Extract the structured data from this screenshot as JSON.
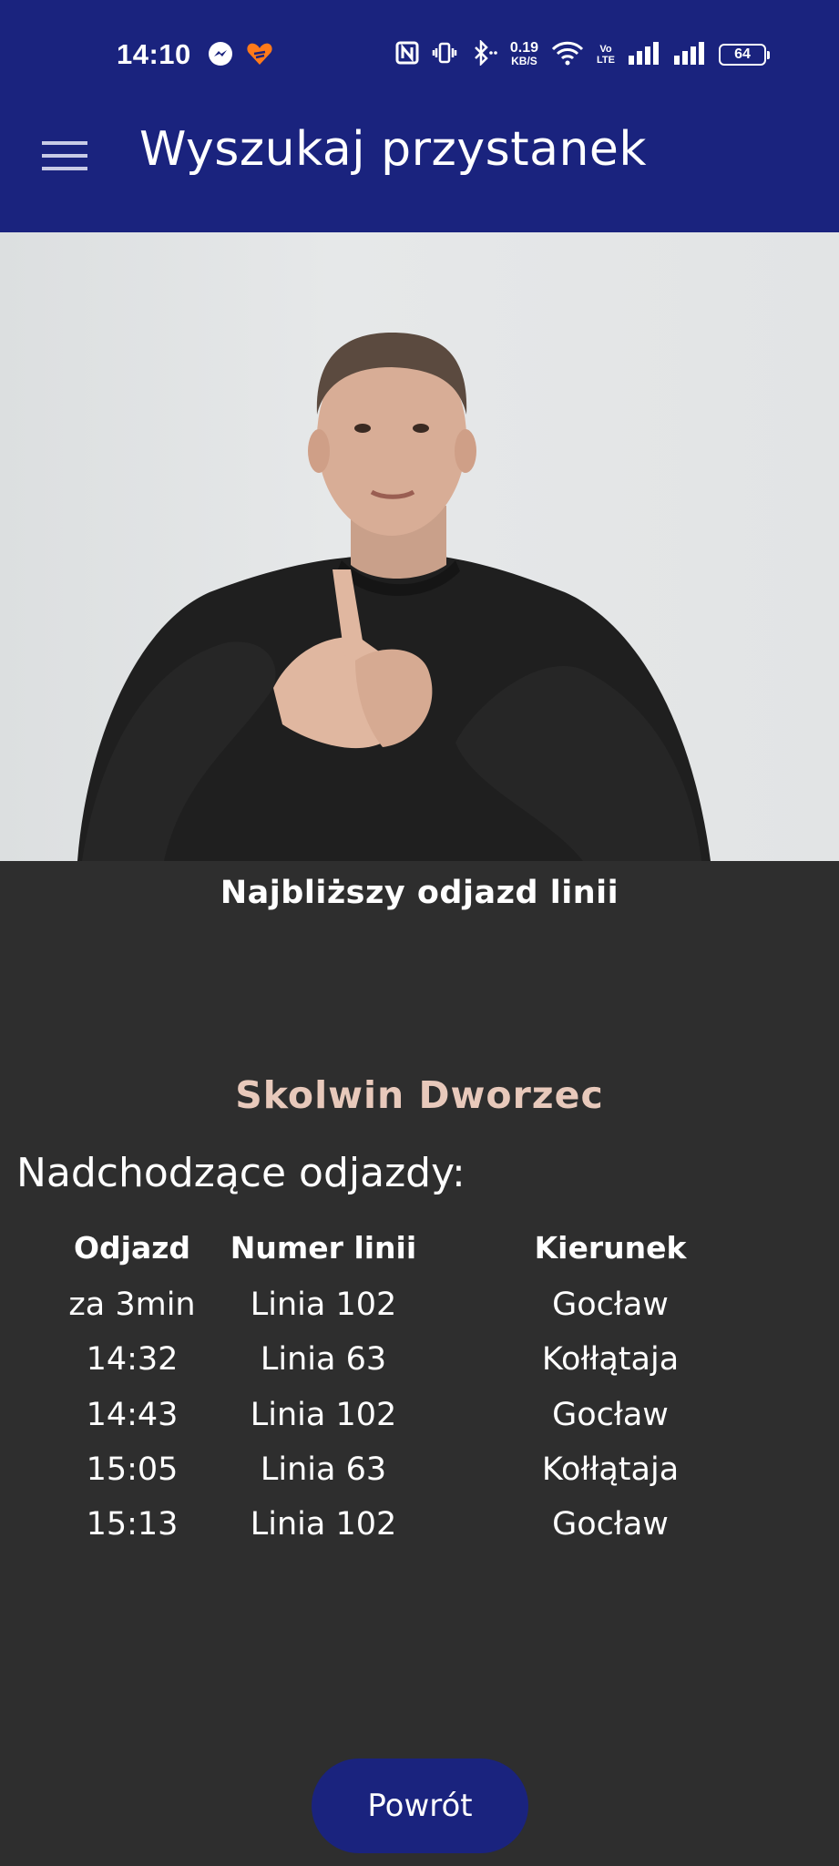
{
  "status_bar": {
    "time": "14:10",
    "left_icons": [
      "messenger-icon",
      "heart-app-icon"
    ],
    "right_icons": [
      "nfc-icon",
      "vibrate-icon",
      "bluetooth-icon",
      "network-speed",
      "wifi-icon",
      "volte-icon",
      "signal-icon",
      "signal-icon",
      "battery-icon"
    ],
    "speed_value": "0.19",
    "speed_unit": "KB/S",
    "volte_top": "Vo",
    "volte_bottom": "LTE",
    "battery": "64"
  },
  "app_bar": {
    "menu_icon": "hamburger-menu-icon",
    "title": "Wyszukaj przystanek"
  },
  "video": {
    "content": "sign-language-interpreter-video"
  },
  "content": {
    "section_heading": "Najbliższy odjazd linii",
    "stop_name": "Skolwin Dworzec",
    "upcoming_label": "Nadchodzące odjazdy:",
    "table": {
      "headers": [
        "Odjazd",
        "Numer linii",
        "Kierunek"
      ],
      "rows": [
        [
          "za 3min",
          "Linia 102",
          "Gocław"
        ],
        [
          "14:32",
          "Linia 63",
          "Kołłątaja"
        ],
        [
          "14:43",
          "Linia 102",
          "Gocław"
        ],
        [
          "15:05",
          "Linia 63",
          "Kołłątaja"
        ],
        [
          "15:13",
          "Linia 102",
          "Gocław"
        ]
      ]
    }
  },
  "back_button": {
    "label": "Powrót"
  },
  "colors": {
    "app_bar": "#1a237e",
    "background": "#2e2e2e",
    "stop_name": "#e8c9bb",
    "button": "#1a237e"
  }
}
